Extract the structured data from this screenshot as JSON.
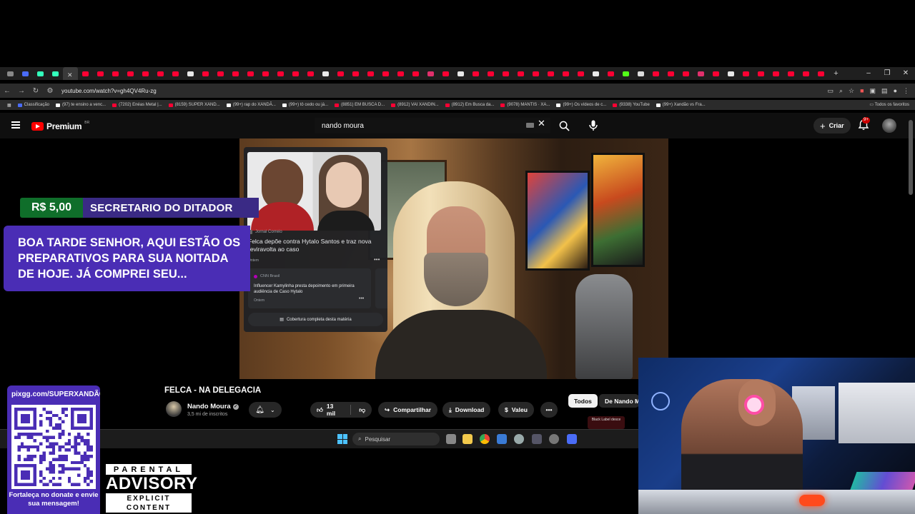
{
  "browser": {
    "url": "youtube.com/watch?v=gh4QV4Ru-zg",
    "bookmarks": [
      {
        "label": "Classificação",
        "color": "#4a6cf7"
      },
      {
        "label": "(97) te ensino a venc...",
        "color": "#ffffff"
      },
      {
        "label": "(7202) Enéas Metal |...",
        "color": "#ff0033"
      },
      {
        "label": "(8159) SUPER XAND...",
        "color": "#ff0033"
      },
      {
        "label": "(99+) rap do XANDÃ...",
        "color": "#ffffff"
      },
      {
        "label": "(99+) tô cedo ou já...",
        "color": "#ffffff"
      },
      {
        "label": "(8851) EM BUSCA D...",
        "color": "#ff0033"
      },
      {
        "label": "(8912) VAI XANDIN...",
        "color": "#ff0033"
      },
      {
        "label": "(8912) Em Busca da...",
        "color": "#ff0033"
      },
      {
        "label": "(9078) MANTIS · XA...",
        "color": "#ff0033"
      },
      {
        "label": "(99+) Os vídeos de c...",
        "color": "#ffffff"
      },
      {
        "label": "(9338) YouTube",
        "color": "#ff0033"
      },
      {
        "label": "(99+) Xandão vs Fra...",
        "color": "#ffffff"
      }
    ],
    "all_favorites": "Todos os favoritos"
  },
  "youtube": {
    "logo_text": "Premium",
    "logo_region": "BR",
    "search_query": "nando moura",
    "create_label": "Criar",
    "notif_badge": "9+"
  },
  "news_card": {
    "source": "Jornal Correio",
    "headline": "Felca depõe contra Hytalo Santos e traz nova reviravolta ao caso",
    "time": "Ontem",
    "sub_source": "CNN Brasil",
    "sub_headline": "Influencer Kamylinha presta depoimento em primeira audiência de Caso Hytalo",
    "sub_time": "Ontem",
    "coverage_label": "Cobertura completa desta matéria"
  },
  "donation": {
    "amount": "R$ 5,00",
    "donor": "SECRETARIO DO DITADOR",
    "message_lines": [
      "BOA TARDE SENHOR, AQUI ESTÃO OS",
      "PREPARATIVOS PARA SUA NOITADA",
      "DE HOJE. JÁ COMPREI SEU..."
    ]
  },
  "video": {
    "title": "FELCA - NA DELEGACIA",
    "channel": "Nando Moura",
    "subscribers": "3,5 mi de inscritos",
    "likes": "13 mil",
    "share_label": "Compartilhar",
    "download_label": "Download",
    "thanks_label": "Valeu"
  },
  "chips": {
    "all": "Todos",
    "from": "De Nando Moura"
  },
  "side_thumb_text": "Black Label desce",
  "taskbar": {
    "search_placeholder": "Pesquisar"
  },
  "pix": {
    "url": "pixgg.com/SUPERXANDÃO",
    "message": "Fortaleça no donate e envie sua mensagem!"
  },
  "parental_advisory": {
    "line1": "PARENTAL",
    "line2": "ADVISORY",
    "line3": "EXPLICIT CONTENT"
  }
}
